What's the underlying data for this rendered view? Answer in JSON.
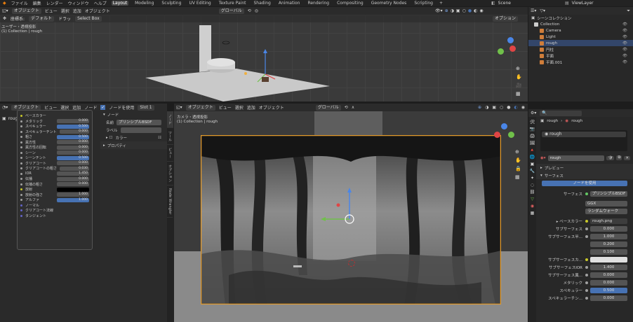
{
  "topbar": {
    "menus": [
      "ファイル",
      "編集",
      "レンダー",
      "ウィンドウ",
      "ヘルプ"
    ],
    "workspaces": [
      "Layout",
      "Modeling",
      "Sculpting",
      "UV Editing",
      "Texture Paint",
      "Shading",
      "Animation",
      "Rendering",
      "Compositing",
      "Geometry Nodes",
      "Scripting"
    ],
    "active_workspace": "Layout",
    "scene": "Scene",
    "view_layer": "ViewLayer"
  },
  "viewport_top": {
    "mode": "オブジェクト",
    "menus": [
      "ビュー",
      "選択",
      "追加",
      "オブジェクト"
    ],
    "transform_orient": "グローバル",
    "tool_row": [
      "座標系:",
      "デフォルト",
      "ドラッ",
      "Select Box"
    ],
    "options": "オプション",
    "overlay_text": "ユーザー・透視投影",
    "overlay_sub": "(1) Collection | rough"
  },
  "outliner": {
    "search_placeholder": "",
    "root": "シーンコレクション",
    "items": [
      {
        "label": "Collection",
        "indent": 0,
        "color": "#cccccc",
        "selected": false
      },
      {
        "label": "Camera",
        "indent": 1,
        "color": "#cf7d3a",
        "selected": false
      },
      {
        "label": "Light",
        "indent": 1,
        "color": "#cf7d3a",
        "selected": false
      },
      {
        "label": "rough",
        "indent": 1,
        "color": "#cf7d3a",
        "selected": true
      },
      {
        "label": "円柱",
        "indent": 1,
        "color": "#cf7d3a",
        "selected": false
      },
      {
        "label": "平面",
        "indent": 1,
        "color": "#cf7d3a",
        "selected": false
      },
      {
        "label": "平面.001",
        "indent": 1,
        "color": "#cf7d3a",
        "selected": false
      }
    ]
  },
  "node_editor": {
    "mode": "オブジェクト",
    "menus": [
      "ビュー",
      "選択",
      "追加",
      "ノード"
    ],
    "use_nodes": "ノードを使用",
    "slot": "Slot 1",
    "object": "rough",
    "panel_title": "ノード",
    "name_label": "名前",
    "name_value": "プリンシプルBSDF",
    "label_label": "ラベル",
    "color_label": "カラー",
    "property_label": "プロパティ",
    "side_tabs": [
      "ノード",
      "ツール",
      "ビュー",
      "オプション",
      "Node Wrangler"
    ],
    "popup_rows": [
      {
        "label": "ベースカラー",
        "value": "",
        "blue": false,
        "dot": "#c7c729"
      },
      {
        "label": "メタリック",
        "value": "0.000",
        "blue": false,
        "dot": "#a1a1a1"
      },
      {
        "label": "スペキュラー",
        "value": "0.500",
        "blue": true,
        "dot": "#a1a1a1"
      },
      {
        "label": "スペキュラーチント",
        "value": "0.000",
        "blue": false,
        "dot": "#a1a1a1"
      },
      {
        "label": "粗さ",
        "value": "0.500",
        "blue": true,
        "dot": "#a1a1a1"
      },
      {
        "label": "異方性",
        "value": "0.000",
        "blue": false,
        "dot": "#a1a1a1"
      },
      {
        "label": "異方性の回転",
        "value": "0.000",
        "blue": false,
        "dot": "#a1a1a1"
      },
      {
        "label": "シーン",
        "value": "0.000",
        "blue": false,
        "dot": "#a1a1a1"
      },
      {
        "label": "シーンチント",
        "value": "0.500",
        "blue": true,
        "dot": "#a1a1a1"
      },
      {
        "label": "クリアコート",
        "value": "0.000",
        "blue": false,
        "dot": "#a1a1a1"
      },
      {
        "label": "クリアコートの粗さ",
        "value": "0.030",
        "blue": false,
        "dot": "#a1a1a1"
      },
      {
        "label": "IOR",
        "value": "1.450",
        "blue": false,
        "dot": "#a1a1a1"
      },
      {
        "label": "伝播",
        "value": "0.000",
        "blue": false,
        "dot": "#a1a1a1"
      },
      {
        "label": "伝播の粗さ",
        "value": "0.000",
        "blue": false,
        "dot": "#a1a1a1"
      },
      {
        "label": "放射",
        "value": "",
        "blue": false,
        "dot": "#c7c729",
        "black": true
      },
      {
        "label": "放射の強さ",
        "value": "1.000",
        "blue": false,
        "dot": "#a1a1a1"
      },
      {
        "label": "アルファ",
        "value": "1.000",
        "blue": true,
        "dot": "#a1a1a1"
      },
      {
        "label": "ノーマル",
        "value": "",
        "blue": false,
        "dot": "#6363c7"
      },
      {
        "label": "クリアコート法線",
        "value": "",
        "blue": false,
        "dot": "#6363c7"
      },
      {
        "label": "タンジェント",
        "value": "",
        "blue": false,
        "dot": "#6363c7"
      }
    ]
  },
  "camera_view": {
    "mode": "オブジェクト",
    "menus": [
      "ビュー",
      "選択",
      "追加",
      "オブジェクト"
    ],
    "transform_orient": "グローバル",
    "overlay_text": "カメラ・透視投影",
    "overlay_sub": "(1) Collection | rough"
  },
  "properties": {
    "breadcrumb_obj": "rough",
    "breadcrumb_mat": "rough",
    "slot_name": "rough",
    "material_name": "rough",
    "preview_label": "プレビュー",
    "surface_label": "サーフェス",
    "use_nodes_btn": "ノードを使用",
    "surface_field_label": "サーフェス",
    "surface_field_value": "プリンシプルBSDF",
    "distribution": "GGX",
    "subsurface_method": "ランダムウォーク",
    "base_color_label": "ベースカラー",
    "base_color_value": "rough.png",
    "rows": [
      {
        "label": "サブサーフェス",
        "value": "0.000",
        "style": "grey",
        "sock": "grey"
      },
      {
        "label": "サブサーフェス半...",
        "value": "1.000",
        "style": "grey",
        "sock": "grey"
      },
      {
        "label": "",
        "value": "0.200",
        "style": "grey",
        "sock": "none"
      },
      {
        "label": "",
        "value": "0.100",
        "style": "grey",
        "sock": "none"
      },
      {
        "label": "サブサーフェスカ...",
        "value": "",
        "style": "white",
        "sock": "y"
      },
      {
        "label": "サブサーフェスIOR",
        "value": "1.400",
        "style": "grey",
        "sock": "grey"
      },
      {
        "label": "サブサーフェス異...",
        "value": "0.000",
        "style": "grey",
        "sock": "grey"
      },
      {
        "label": "メタリック",
        "value": "0.000",
        "style": "grey",
        "sock": "grey"
      },
      {
        "label": "スペキュラー",
        "value": "0.500",
        "style": "blue",
        "sock": "grey"
      },
      {
        "label": "スペキュラーチン...",
        "value": "0.000",
        "style": "grey",
        "sock": "grey"
      }
    ]
  }
}
